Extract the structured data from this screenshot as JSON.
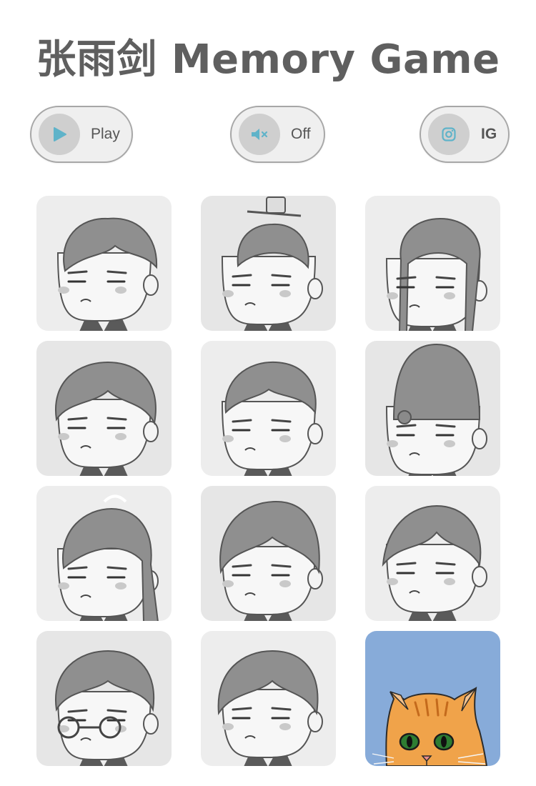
{
  "title": "张雨剑 Memory Game",
  "controls": {
    "play": {
      "label": "Play",
      "icon": "play-icon"
    },
    "sound": {
      "label": "Off",
      "icon": "mute-icon"
    },
    "instagram": {
      "label": "IG",
      "icon": "instagram-icon"
    }
  },
  "colors": {
    "accent": "#5fb3c9",
    "card_face_down": "#e6e6e6",
    "card_revealed": "#87abd9",
    "title": "#5f5f5f"
  },
  "cards": [
    {
      "id": 1,
      "state": "face-down",
      "icon": "character-messy-hair-icon"
    },
    {
      "id": 2,
      "state": "face-down",
      "icon": "character-topknot-crown-icon"
    },
    {
      "id": 3,
      "state": "face-down",
      "icon": "character-long-braided-hair-icon"
    },
    {
      "id": 4,
      "state": "face-down",
      "icon": "character-bangs-icon"
    },
    {
      "id": 5,
      "state": "face-down",
      "icon": "character-teary-eyes-icon"
    },
    {
      "id": 6,
      "state": "face-down",
      "icon": "character-tall-hat-icon"
    },
    {
      "id": 7,
      "state": "face-down",
      "icon": "character-ponytail-icon"
    },
    {
      "id": 8,
      "state": "face-down",
      "icon": "character-annoyed-icon"
    },
    {
      "id": 9,
      "state": "face-down",
      "icon": "character-squint-icon"
    },
    {
      "id": 10,
      "state": "face-down",
      "icon": "character-round-glasses-icon"
    },
    {
      "id": 11,
      "state": "face-down",
      "icon": "character-pout-icon"
    },
    {
      "id": 12,
      "state": "revealed",
      "icon": "orange-cat-icon"
    }
  ]
}
